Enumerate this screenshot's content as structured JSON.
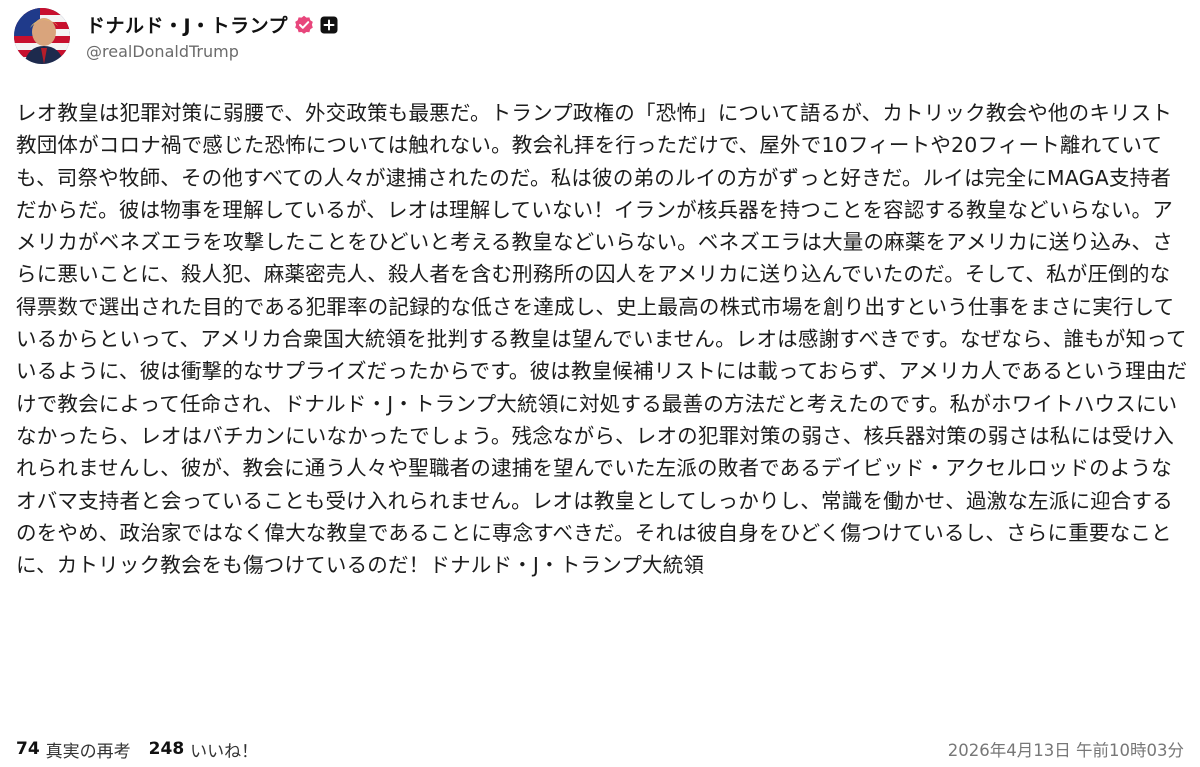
{
  "author": {
    "display_name": "ドナルド・J・トランプ",
    "handle": "@realDonaldTrump",
    "verified_icon": "verified-badge-icon",
    "verified_color": "#e8467c",
    "plus_icon": "plus-square-icon"
  },
  "post": {
    "text": "レオ教皇は犯罪対策に弱腰で、外交政策も最悪だ。トランプ政権の「恐怖」について語るが、カトリック教会や他のキリスト教団体がコロナ禍で感じた恐怖については触れない。教会礼拝を行っただけで、屋外で10フィートや20フィート離れていても、司祭や牧師、その他すべての人々が逮捕されたのだ。私は彼の弟のルイの方がずっと好きだ。ルイは完全にMAGA支持者だからだ。彼は物事を理解しているが、レオは理解していない！イランが核兵器を持つことを容認する教皇などいらない。アメリカがベネズエラを攻撃したことをひどいと考える教皇などいらない。ベネズエラは大量の麻薬をアメリカに送り込み、さらに悪いことに、殺人犯、麻薬密売人、殺人者を含む刑務所の囚人をアメリカに送り込んでいたのだ。そして、私が圧倒的な得票数で選出された目的である犯罪率の記録的な低さを達成し、史上最高の株式市場を創り出すという仕事をまさに実行しているからといって、アメリカ合衆国大統領を批判する教皇は望んでいません。レオは感謝すべきです。なぜなら、誰もが知っているように、彼は衝撃的なサプライズだったからです。彼は教皇候補リストには載っておらず、アメリカ人であるという理由だけで教会によって任命され、ドナルド・J・トランプ大統領に対処する最善の方法だと考えたのです。私がホワイトハウスにいなかったら、レオはバチカンにいなかったでしょう。残念ながら、レオの犯罪対策の弱さ、核兵器対策の弱さは私には受け入れられませんし、彼が、教会に通う人々や聖職者の逮捕を望んでいた左派の敗者であるデイビッド・アクセルロッドのようなオバマ支持者と会っていることも受け入れられません。レオは教皇としてしっかりし、常識を働かせ、過激な左派に迎合するのをやめ、政治家ではなく偉大な教皇であることに専念すべきだ。それは彼自身をひどく傷つけているし、さらに重要なことに、カトリック教会をも傷つけているのだ！ドナルド・J・トランプ大統領"
  },
  "stats": {
    "retruths_count": "74",
    "retruths_label": "真実の再考",
    "likes_count": "248",
    "likes_label": "いいね！"
  },
  "timestamp": "2026年4月13日 午前10時03分"
}
